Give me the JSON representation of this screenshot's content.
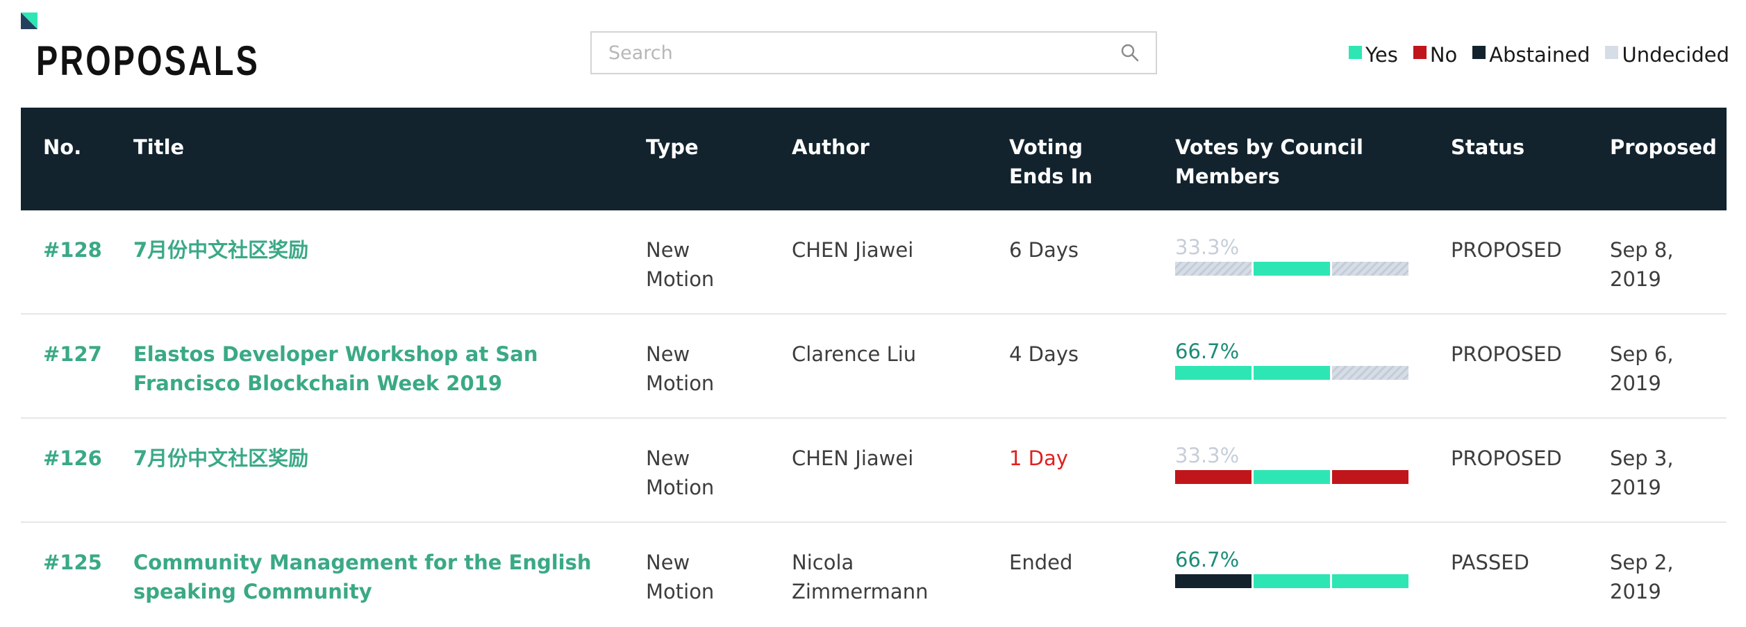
{
  "header": {
    "title": "PROPOSALS",
    "search": {
      "placeholder": "Search",
      "value": ""
    },
    "legend": [
      {
        "label": "Yes",
        "color": "#2ee6b4"
      },
      {
        "label": "No",
        "color": "#c0161b"
      },
      {
        "label": "Abstained",
        "color": "#12232e"
      },
      {
        "label": "Undecided",
        "color": "#d6dde6"
      }
    ]
  },
  "table": {
    "columns": [
      "No.",
      "Title",
      "Type",
      "Author",
      "Voting Ends In",
      "Votes by Council Members",
      "Status",
      "Proposed"
    ],
    "rows": [
      {
        "no": "#128",
        "title": "7月份中文社区奖励",
        "type": "New Motion",
        "author": "CHEN Jiawei",
        "ends": "6 Days",
        "ends_urgent": false,
        "pct": "33.3%",
        "pct_level": "low",
        "votes": [
          "undecided",
          "yes",
          "undecided"
        ],
        "status": "PROPOSED",
        "proposed": "Sep 8, 2019"
      },
      {
        "no": "#127",
        "title": "Elastos Developer Workshop at San Francisco Blockchain Week 2019",
        "type": "New Motion",
        "author": "Clarence Liu",
        "ends": "4 Days",
        "ends_urgent": false,
        "pct": "66.7%",
        "pct_level": "high",
        "votes": [
          "yes",
          "yes",
          "undecided"
        ],
        "status": "PROPOSED",
        "proposed": "Sep 6, 2019"
      },
      {
        "no": "#126",
        "title": "7月份中文社区奖励",
        "type": "New Motion",
        "author": "CHEN Jiawei",
        "ends": "1 Day",
        "ends_urgent": true,
        "pct": "33.3%",
        "pct_level": "low",
        "votes": [
          "no",
          "yes",
          "no"
        ],
        "status": "PROPOSED",
        "proposed": "Sep 3, 2019"
      },
      {
        "no": "#125",
        "title": "Community Management for the English speaking Community",
        "type": "New Motion",
        "author": "Nicola Zimmermann",
        "ends": "Ended",
        "ends_urgent": false,
        "pct": "66.7%",
        "pct_level": "high",
        "votes": [
          "abstained",
          "yes",
          "yes"
        ],
        "status": "PASSED",
        "proposed": "Sep 2, 2019"
      }
    ]
  },
  "colors": {
    "accent": "#3aa985",
    "header_bg": "#12232e",
    "urgent": "#e02020",
    "yes": "#2ee6b4",
    "no": "#c0161b",
    "abstained": "#12232e",
    "undecided": "#d6dde6"
  }
}
